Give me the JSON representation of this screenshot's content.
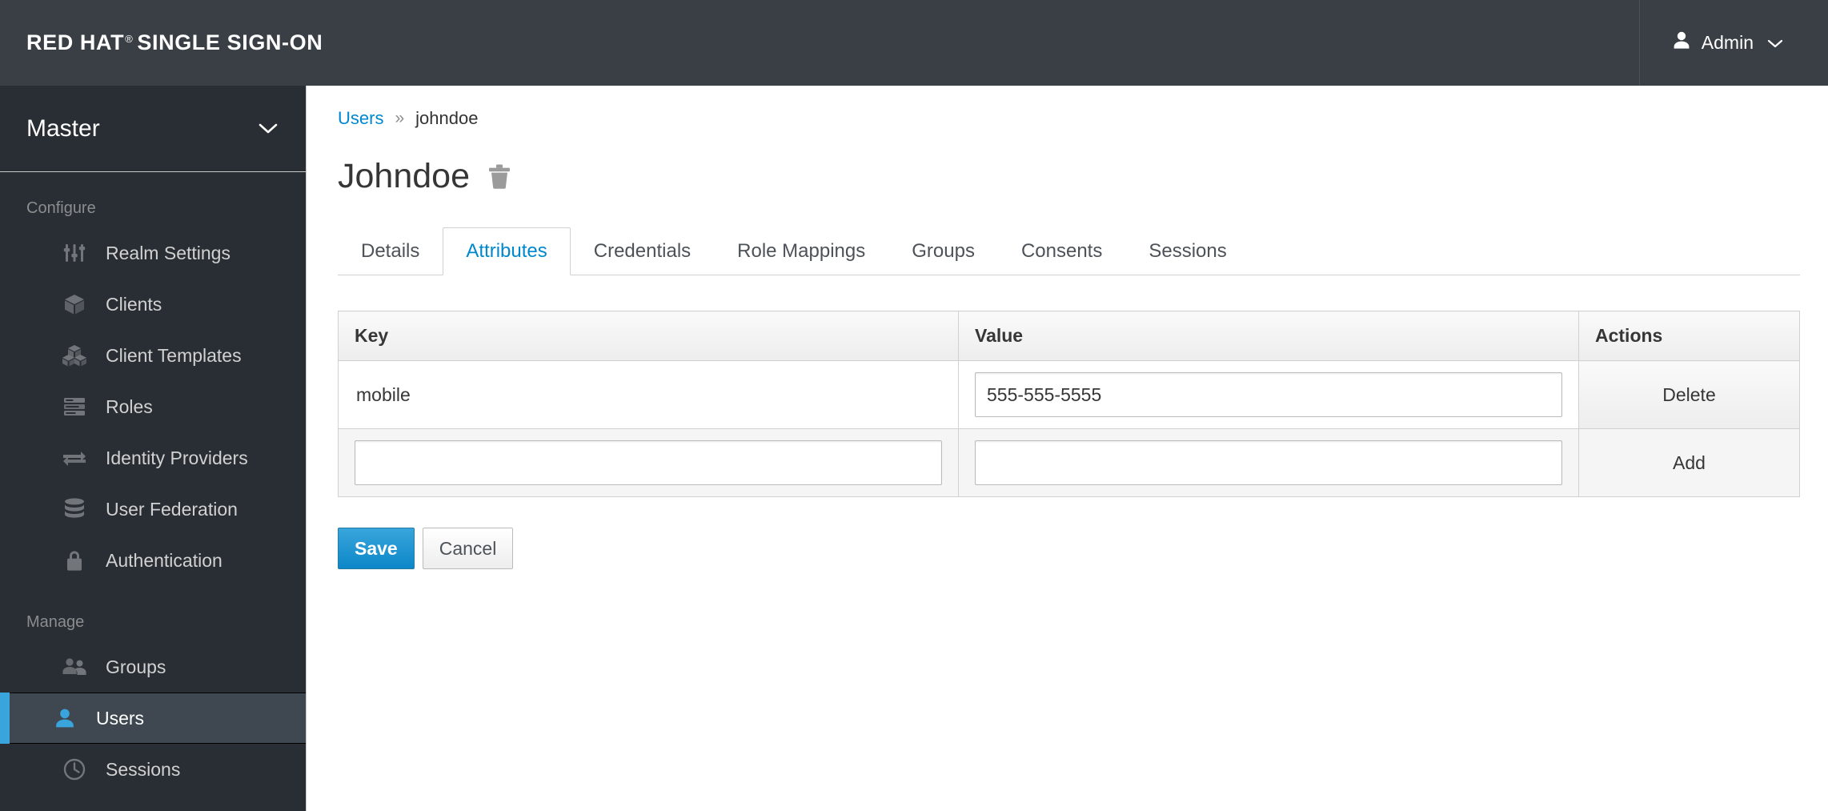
{
  "header": {
    "brand_bold": "RED HAT",
    "brand_reg": "®",
    "brand_rest": "SINGLE SIGN-ON",
    "user_menu_label": "Admin",
    "user_icon": "user-icon",
    "caret_icon": "chevron-down-icon"
  },
  "sidebar": {
    "realm": {
      "name": "Master",
      "caret_icon": "chevron-down-icon"
    },
    "sections": [
      {
        "title": "Configure",
        "items": [
          {
            "label": "Realm Settings",
            "icon": "sliders-icon",
            "active": false
          },
          {
            "label": "Clients",
            "icon": "cube-icon",
            "active": false
          },
          {
            "label": "Client Templates",
            "icon": "cubes-icon",
            "active": false
          },
          {
            "label": "Roles",
            "icon": "list-bars-icon",
            "active": false
          },
          {
            "label": "Identity Providers",
            "icon": "exchange-arrows-icon",
            "active": false
          },
          {
            "label": "User Federation",
            "icon": "database-icon",
            "active": false
          },
          {
            "label": "Authentication",
            "icon": "lock-icon",
            "active": false
          }
        ]
      },
      {
        "title": "Manage",
        "items": [
          {
            "label": "Groups",
            "icon": "users-group-icon",
            "active": false
          },
          {
            "label": "Users",
            "icon": "user-icon",
            "active": true
          },
          {
            "label": "Sessions",
            "icon": "clock-icon",
            "active": false
          }
        ]
      }
    ]
  },
  "breadcrumb": {
    "parent": "Users",
    "separator": "»",
    "current": "johndoe"
  },
  "page": {
    "title": "Johndoe",
    "delete_icon": "trash-icon"
  },
  "tabs": [
    {
      "label": "Details",
      "active": false
    },
    {
      "label": "Attributes",
      "active": true
    },
    {
      "label": "Credentials",
      "active": false
    },
    {
      "label": "Role Mappings",
      "active": false
    },
    {
      "label": "Groups",
      "active": false
    },
    {
      "label": "Consents",
      "active": false
    },
    {
      "label": "Sessions",
      "active": false
    }
  ],
  "attributes_table": {
    "columns": [
      "Key",
      "Value",
      "Actions"
    ],
    "rows": [
      {
        "key": "mobile",
        "key_is_input": false,
        "value": "555-555-5555",
        "value_placeholder": "",
        "action": "Delete"
      },
      {
        "key": "",
        "key_is_input": true,
        "value": "",
        "value_placeholder": "",
        "action": "Add"
      }
    ]
  },
  "form_buttons": {
    "save": "Save",
    "cancel": "Cancel"
  },
  "colors": {
    "masthead_bg": "#393f44",
    "sidebar_bg": "#292e34",
    "accent_blue": "#0088ce",
    "active_nav_bg": "#3f4850",
    "active_nav_border": "#39a5dc",
    "link_blue": "#0088ce",
    "text_dark": "#363636",
    "muted_text": "#8b8d8f"
  }
}
